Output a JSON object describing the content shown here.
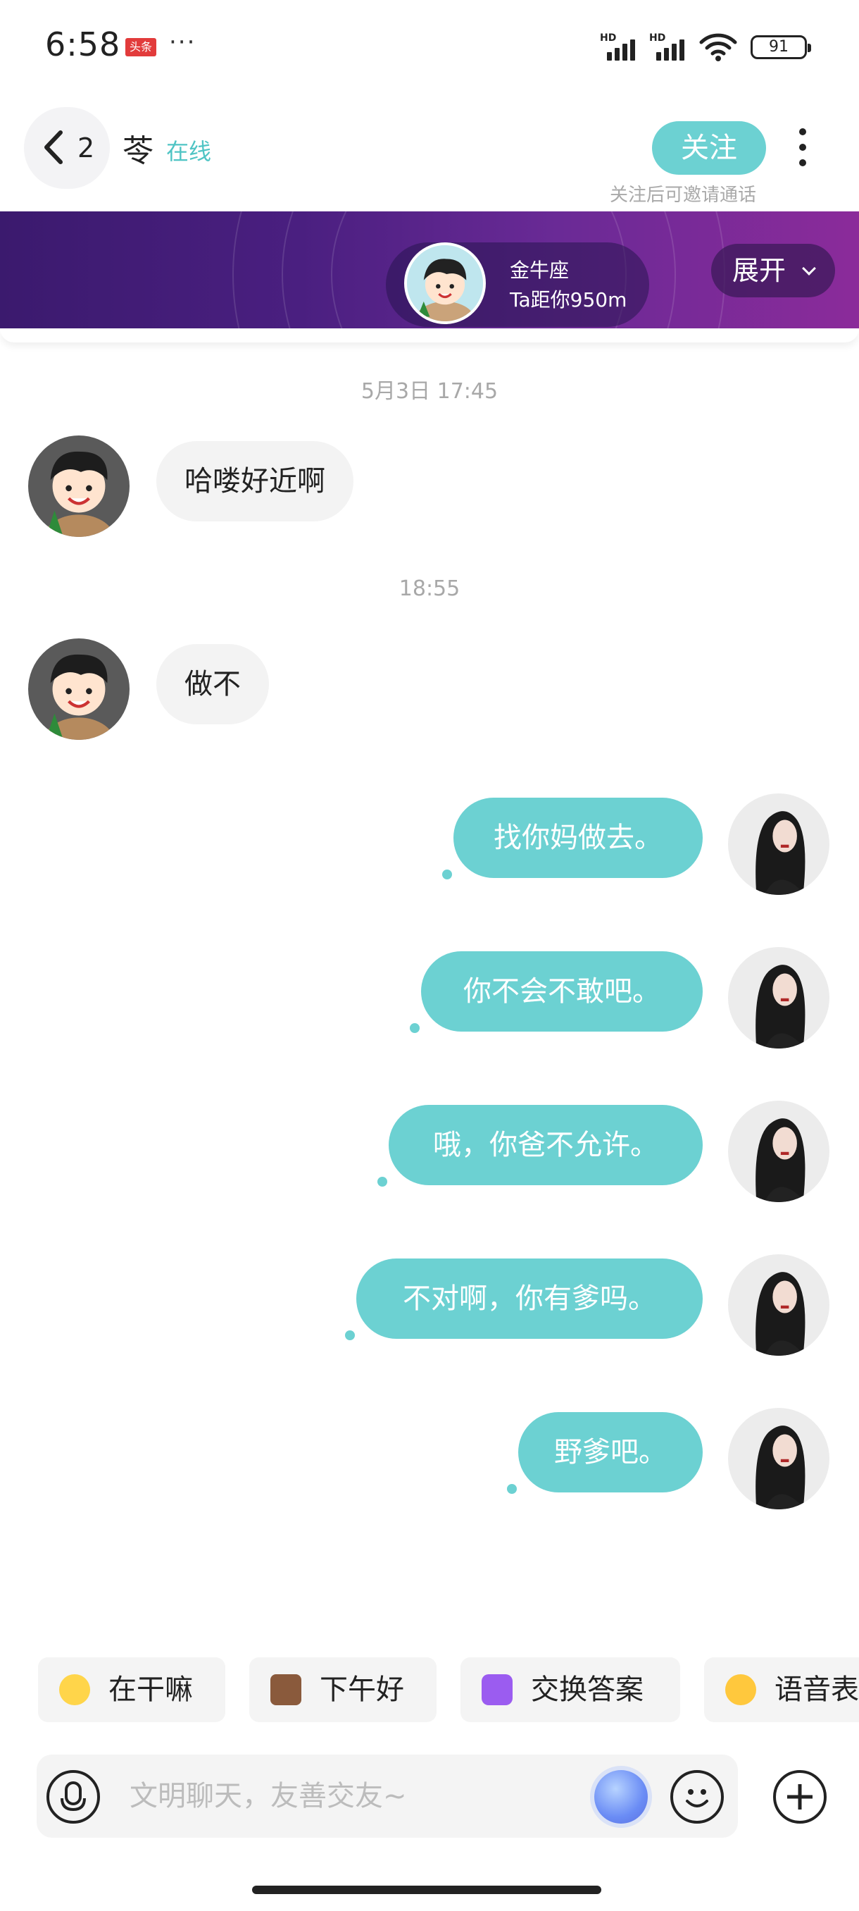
{
  "status_bar": {
    "time": "6:58",
    "news_badge": "头条",
    "more": "···",
    "hd1": "HD",
    "hd2": "HD",
    "battery": "91"
  },
  "header": {
    "back_count": "2",
    "contact_name": "苓",
    "online_status": "在线",
    "follow_label": "关注",
    "follow_hint": "关注后可邀请通话"
  },
  "banner": {
    "zodiac": "金牛座",
    "distance": "Ta距你950m",
    "expand_label": "展开"
  },
  "messages": [
    {
      "type": "timestamp",
      "text": "5月3日 17:45"
    },
    {
      "type": "incoming",
      "text": "哈喽好近啊"
    },
    {
      "type": "timestamp",
      "text": "18:55"
    },
    {
      "type": "incoming",
      "text": "做不"
    },
    {
      "type": "outgoing",
      "text": "找你妈做去。"
    },
    {
      "type": "outgoing",
      "text": "你不会不敢吧。"
    },
    {
      "type": "outgoing",
      "text": "哦，你爸不允许。"
    },
    {
      "type": "outgoing",
      "text": "不对啊，你有爹吗。"
    },
    {
      "type": "outgoing",
      "text": "野爹吧。"
    }
  ],
  "quick_replies": [
    {
      "label": "在干嘛",
      "icon": "thinking-face-icon"
    },
    {
      "label": "下午好",
      "icon": "coffee-cup-icon"
    },
    {
      "label": "交换答案",
      "icon": "exchange-icon"
    },
    {
      "label": "语音表",
      "icon": "smiling-face-icon"
    }
  ],
  "input": {
    "placeholder": "文明聊天，友善交友~"
  },
  "colors": {
    "accent": "#6cd1d2",
    "banner_start": "#3b1a6e",
    "banner_end": "#8b2b9a"
  }
}
